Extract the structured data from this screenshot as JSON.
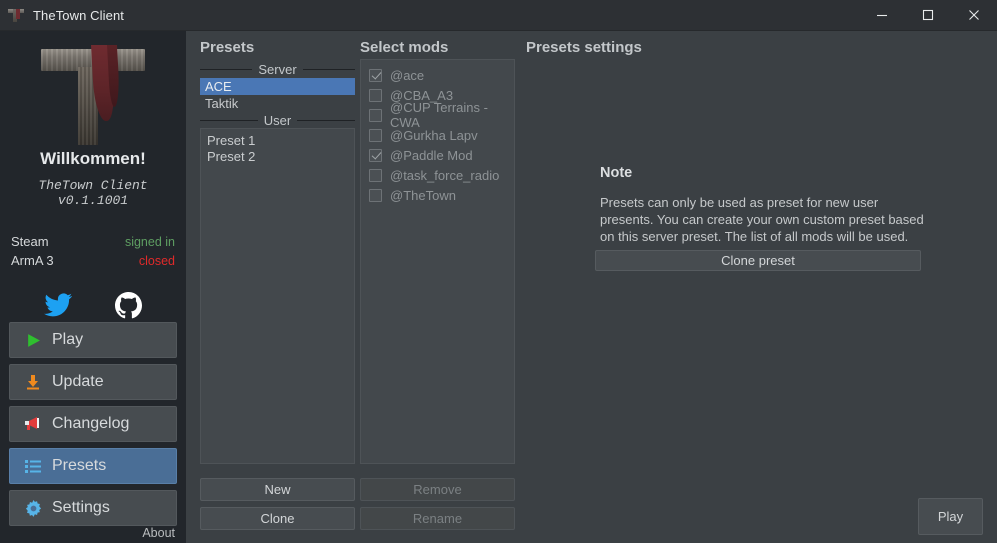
{
  "window": {
    "title": "TheTown Client",
    "icon": "cross-beam-icon",
    "controls": {
      "minimize": "minimize-icon",
      "maximize": "maximize-icon",
      "close": "close-icon"
    }
  },
  "sidebar": {
    "logo_alt": "thetown-cross-logo",
    "welcome": "Willkommen!",
    "version": "TheTown Client v0.1.1001",
    "status": [
      {
        "label": "Steam",
        "value": "signed in",
        "color": "#5e9e62"
      },
      {
        "label": "ArmA 3",
        "value": "closed",
        "color": "#e02a2a"
      }
    ],
    "socials": [
      {
        "name": "twitter-icon",
        "color": "#1da1f2"
      },
      {
        "name": "github-icon",
        "color": "#ffffff"
      }
    ],
    "nav": [
      {
        "label": "Play",
        "icon": "play-icon",
        "active": false
      },
      {
        "label": "Update",
        "icon": "download-icon",
        "active": false
      },
      {
        "label": "Changelog",
        "icon": "megaphone-icon",
        "active": false
      },
      {
        "label": "Presets",
        "icon": "list-icon",
        "active": true
      },
      {
        "label": "Settings",
        "icon": "gear-icon",
        "active": false
      }
    ],
    "about": "About"
  },
  "presets": {
    "title": "Presets",
    "server_separator": "Server",
    "server_items": [
      {
        "label": "ACE",
        "selected": true
      },
      {
        "label": "Taktik",
        "selected": false
      }
    ],
    "user_separator": "User",
    "user_items": [
      {
        "label": "Preset 1",
        "selected": false
      },
      {
        "label": "Preset 2",
        "selected": false
      }
    ],
    "buttons": [
      {
        "label": "New",
        "disabled": false
      },
      {
        "label": "Clone",
        "disabled": false
      }
    ]
  },
  "mods": {
    "title": "Select mods",
    "items": [
      {
        "label": "@ace",
        "checked": true
      },
      {
        "label": "@CBA_A3",
        "checked": false
      },
      {
        "label": "@CUP Terrains - CWA",
        "checked": false
      },
      {
        "label": "@Gurkha Lapv",
        "checked": false
      },
      {
        "label": "@Paddle Mod",
        "checked": true
      },
      {
        "label": "@task_force_radio",
        "checked": false
      },
      {
        "label": "@TheTown",
        "checked": false
      }
    ],
    "buttons": [
      {
        "label": "Remove",
        "disabled": true
      },
      {
        "label": "Rename",
        "disabled": true
      }
    ]
  },
  "settings": {
    "title": "Presets settings",
    "note_title": "Note",
    "note_body": "Presets can only be used as preset for new user presents. You can create your own custom preset based on this server preset. The list of all mods will be used.",
    "clone_button": "Clone preset"
  },
  "footer": {
    "play_button": "Play"
  }
}
